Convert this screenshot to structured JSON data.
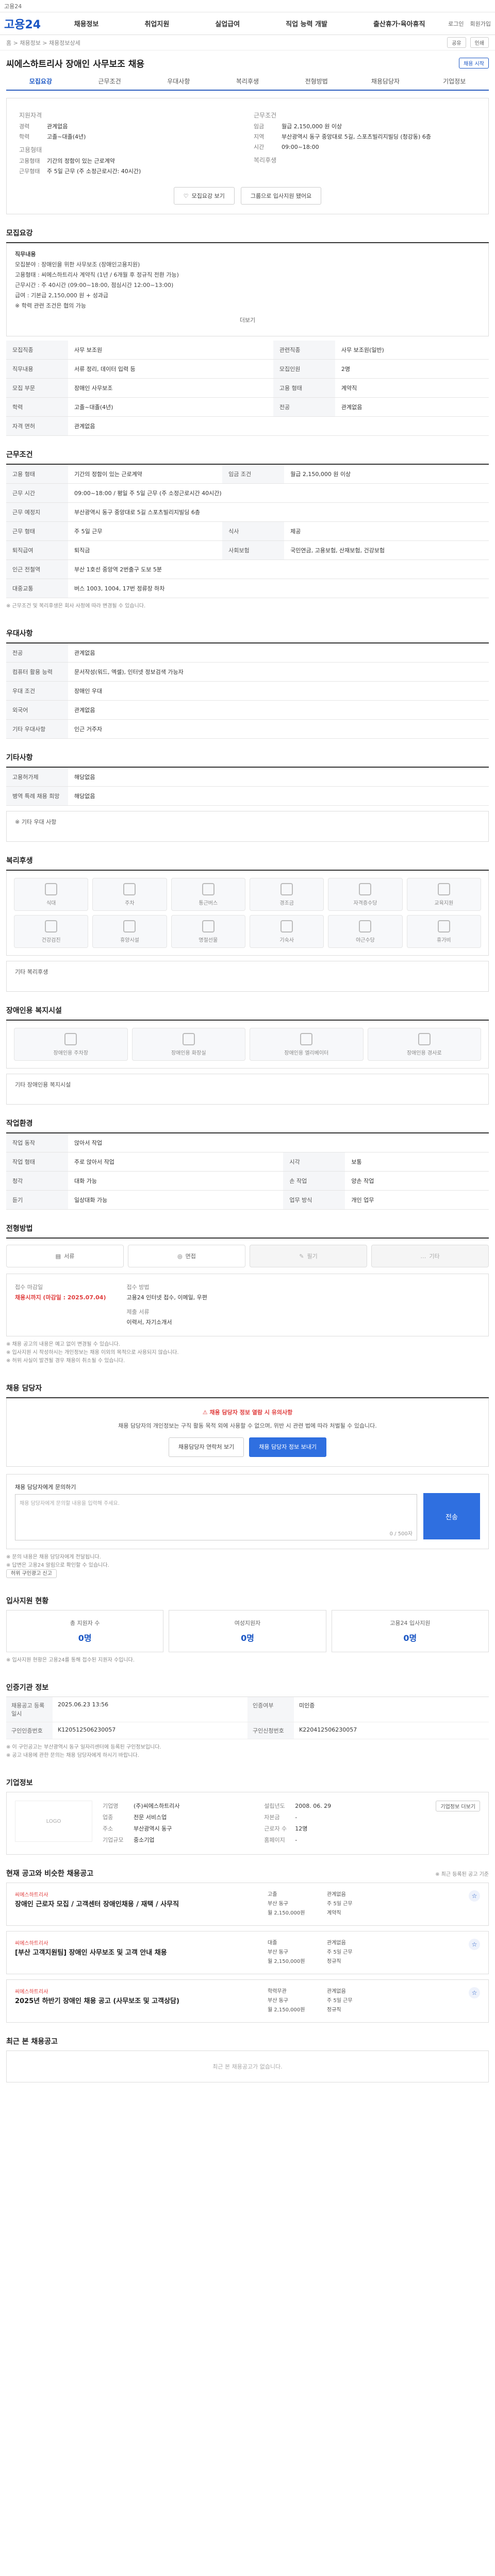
{
  "topbar": {
    "text": "고용24"
  },
  "header": {
    "logo": "고용24",
    "nav": [
      "채용정보",
      "취업지원",
      "실업급여",
      "직업 능력 개발",
      "출산휴가·육아휴직"
    ],
    "right": [
      "로그인",
      "회원가입"
    ]
  },
  "breadcrumb": {
    "path": "홈 > 채용정보 > 채용정보상세",
    "share": "공유",
    "print": "인쇄"
  },
  "title": "씨에스하트리사 장애인 사무보조 채용",
  "title_badge": "채용 시작",
  "tabs": [
    "모집요강",
    "근무조건",
    "우대사항",
    "복리후생",
    "전형방법",
    "채용담당자",
    "기업정보"
  ],
  "summary": {
    "left_heading": "지원자격",
    "left": [
      {
        "k": "경력",
        "v": "관계없음"
      },
      {
        "k": "학력",
        "v": "고졸~대졸(4년)"
      }
    ],
    "left_heading2": "고용형태",
    "left2": [
      {
        "k": "고용형태",
        "v": "기간의 정함이 있는 근로계약"
      },
      {
        "k": "근무형태",
        "v": "주 5일 근무 (주 소정근로시간: 40시간)"
      }
    ],
    "right_heading": "근무조건",
    "right": [
      {
        "k": "임금",
        "v": "월급 2,150,000 원 이상"
      },
      {
        "k": "지역",
        "v": "부산광역시 동구 중앙대로 5길, 스포츠빌리지빌딩 (청강동) 6층"
      },
      {
        "k": "시간",
        "v": "09:00~18:00"
      }
    ],
    "right_heading2": "복리후생",
    "btn_info": "모집요강 보기",
    "btn_apply": "그룹으로 입사지원 됐어요"
  },
  "recruit": {
    "heading": "모집요강",
    "lines": [
      "직무내용",
      "모집분야 : 장애인을 위한 사무보조 (장애인고용지원)",
      "고용형태 : 씨에스하트리사 계약직 (1년 / 6개월 후 정규직 전환 가능)",
      "근무시간 : 주 40시간 (09:00~18:00, 점심시간 12:00~13:00)",
      "급여 : 기본급 2,150,000 원 + 성과급",
      "※ 학력 관련 조건은 협의 가능"
    ],
    "more": "더보기",
    "rows": [
      {
        "k": "모집직종",
        "v": "사무 보조원",
        "k2": "관련직종",
        "v2": "사무 보조원(일반)"
      },
      {
        "k": "직무내용",
        "v": "서류 정리, 데이터 입력 등",
        "k2": "모집인원",
        "v2": "2명"
      },
      {
        "k": "모집 부문",
        "v": "장애인 사무보조",
        "k2": "고용 형태",
        "v2": "계약직"
      },
      {
        "k": "학력",
        "v": "고졸~대졸(4년)",
        "k2": "전공",
        "v2": "관계없음"
      },
      {
        "k": "자격 면허",
        "v": "관계없음",
        "k2": "",
        "v2": ""
      }
    ]
  },
  "conditions": {
    "heading": "근무조건",
    "rows": [
      {
        "k": "고용 형태",
        "v": "기간의 정함이 있는 근로계약",
        "k2": "임금 조건",
        "v2": "월급 2,150,000 원 이상"
      },
      {
        "k": "근무 시간",
        "v": "09:00~18:00 / 평일 주 5일 근무 (주 소정근로시간 40시간)",
        "k2": "",
        "v2": ""
      },
      {
        "k": "근무 예정지",
        "v": "부산광역시 동구 중앙대로 5길 스포츠빌리지빌딩 6층",
        "k2": "",
        "v2": ""
      },
      {
        "k": "근무 형태",
        "v": "주 5일 근무",
        "k2": "식사",
        "v2": "제공"
      },
      {
        "k": "퇴직급여",
        "v": "퇴직금",
        "k2": "사회보험",
        "v2": "국민연금, 고용보험, 산재보험, 건강보험"
      },
      {
        "k": "인근 전철역",
        "v": "부산 1호선 중앙역 2번출구 도보 5분",
        "k2": "",
        "v2": ""
      },
      {
        "k": "대중교통",
        "v": "버스 1003, 1004, 17번 정류장 하차",
        "k2": "",
        "v2": ""
      }
    ],
    "note": "※ 근무조건 및 복리후생은 회사 사정에 따라 변경될 수 있습니다."
  },
  "preference": {
    "heading": "우대사항",
    "rows": [
      {
        "k": "전공",
        "v": "관계없음"
      },
      {
        "k": "컴퓨터 활용 능력",
        "v": "문서작성(워드, 엑셀), 인터넷 정보검색 가능자"
      },
      {
        "k": "우대 조건",
        "v": "장애인 우대"
      },
      {
        "k": "외국어",
        "v": "관계없음"
      },
      {
        "k": "기타 우대사항",
        "v": "인근 거주자"
      }
    ]
  },
  "etc": {
    "heading": "기타사항",
    "rows": [
      {
        "k": "고용허가제",
        "v": "해당없음"
      },
      {
        "k": "병역 특례 채용 희망",
        "v": "해당없음"
      }
    ],
    "extra": "※ 기타 우대 사항"
  },
  "welfare": {
    "heading": "복리후생",
    "items": [
      "식대",
      "주차",
      "통근버스",
      "경조금",
      "자격증수당",
      "교육지원",
      "건강검진",
      "휴양시설",
      "명절선물",
      "기숙사",
      "야근수당",
      "휴가비"
    ],
    "extra": "기타 복리후생"
  },
  "disability": {
    "heading": "장애인용 복지시설",
    "items": [
      "장애인용 주차장",
      "장애인용 화장실",
      "장애인용 엘리베이터",
      "장애인용 경사로"
    ],
    "extra": "기타 장애인용 복지시설"
  },
  "env": {
    "heading": "작업환경",
    "rows": [
      {
        "k": "작업 동작",
        "v": "앉아서 작업",
        "k2": "",
        "v2": ""
      },
      {
        "k": "작업 형태",
        "v": "주로 앉아서 작업",
        "k2": "시각",
        "v2": "보통"
      },
      {
        "k": "청각",
        "v": "대화 가능",
        "k2": "손 작업",
        "v2": "양손 작업"
      },
      {
        "k": "듣기",
        "v": "일상대화 가능",
        "k2": "업무 방식",
        "v2": "개인 업무"
      }
    ]
  },
  "selection": {
    "heading": "전형방법",
    "methods": [
      "서류",
      "면접",
      "필기",
      "기타"
    ],
    "apply_title": "접수 마감일",
    "apply_date": "채용시까지 (마감일 : 2025.07.04)",
    "apply_way_k": "접수 방법",
    "apply_way_v": "고용24 인터넷 접수, 이메일, 우편",
    "docs_k": "제출 서류",
    "docs_v": "이력서, 자기소개서",
    "notes": [
      "※ 채용 공고의 내용은 예고 없이 변경될 수 있습니다.",
      "※ 입사지원 시 작성하시는 개인정보는 채용 이외의 목적으로 사용되지 않습니다.",
      "※ 허위 사실이 발견될 경우 채용이 취소될 수 있습니다."
    ]
  },
  "contact": {
    "heading": "채용 담당자",
    "alert_title": "채용 담당자 정보 열람 시 유의사항",
    "alert_body": "채용 담당자의 개인정보는 구직 활동 목적 외에 사용할 수 없으며, 위반 시 관련 법에 따라 처벌될 수 있습니다.",
    "btn1": "채용담당자 연락처 보기",
    "btn2": "채용 담당자 정보 보내기",
    "inquiry_label": "채용 담당자에게 문의하기",
    "inquiry_placeholder": "채용 담당자에게 문의할 내용을 입력해 주세요.",
    "inquiry_count": "0 / 500자",
    "send": "전송",
    "notes": [
      "※ 문의 내용은 채용 담당자에게 전달됩니다.",
      "※ 답변은 고용24 알림으로 확인할 수 있습니다."
    ],
    "report": "허위 구인광고 신고"
  },
  "status": {
    "heading": "입사지원 현황",
    "items": [
      {
        "label": "총 지원자 수",
        "value": "0명"
      },
      {
        "label": "여성지원자",
        "value": "0명"
      },
      {
        "label": "고용24 입사지원",
        "value": "0명"
      }
    ],
    "note": "※ 입사지원 현황은 고용24를 통해 접수된 지원자 수입니다."
  },
  "posting": {
    "heading": "인증기관 정보",
    "rows": [
      {
        "k": "채용공고 등록일시",
        "v": "2025.06.23 13:56",
        "k2": "인증여부",
        "v2": "미인증"
      },
      {
        "k": "구인인증번호",
        "v": "K120512506230057",
        "k2": "구인신청번호",
        "v2": "K220412506230057"
      }
    ],
    "notes": [
      "※ 이 구인공고는 부산광역시 동구 일자리센터에 등록된 구인정보입니다.",
      "※ 공고 내용에 관한 문의는 채용 담당자에게 하시기 바랍니다."
    ]
  },
  "company": {
    "heading": "기업정보",
    "logo": "LOGO",
    "rows": [
      {
        "k": "기업명",
        "v": "(주)씨에스하트리사",
        "k2": "설립년도",
        "v2": "2008. 06. 29"
      },
      {
        "k": "업종",
        "v": "전문 서비스업",
        "k2": "자본금",
        "v2": "-"
      },
      {
        "k": "주소",
        "v": "부산광역시 동구",
        "k2": "근로자 수",
        "v2": "12명"
      },
      {
        "k": "기업규모",
        "v": "중소기업",
        "k2": "홈페이지",
        "v2": "-"
      }
    ],
    "btn": "기업정보 더보기"
  },
  "similar": {
    "heading": "현재 공고와 비슷한 채용공고",
    "note": "※ 최근 등록된 공고 기준",
    "jobs": [
      {
        "co": "씨에스하트리사",
        "title": "장애인 근로자 모집 / 고객센터 장애인채용 / 재택 / 사무직",
        "meta": [
          "고졸",
          "관계없음",
          "부산 동구",
          "주 5일 근무",
          "월 2,150,000원",
          "계약직"
        ]
      },
      {
        "co": "씨에스하트리사",
        "title": "[부산 고객지원팀] 장애인 사무보조 및 고객 안내 채용",
        "meta": [
          "대졸",
          "관계없음",
          "부산 동구",
          "주 5일 근무",
          "월 2,150,000원",
          "정규직"
        ]
      },
      {
        "co": "씨에스하트리사",
        "title": "2025년 하반기 장애인 채용 공고 (사무보조 및 고객상담)",
        "meta": [
          "학력무관",
          "관계없음",
          "부산 동구",
          "주 5일 근무",
          "월 2,150,000원",
          "정규직"
        ]
      }
    ]
  },
  "recent": {
    "heading": "최근 본 채용공고",
    "empty": "최근 본 채용공고가 없습니다."
  }
}
